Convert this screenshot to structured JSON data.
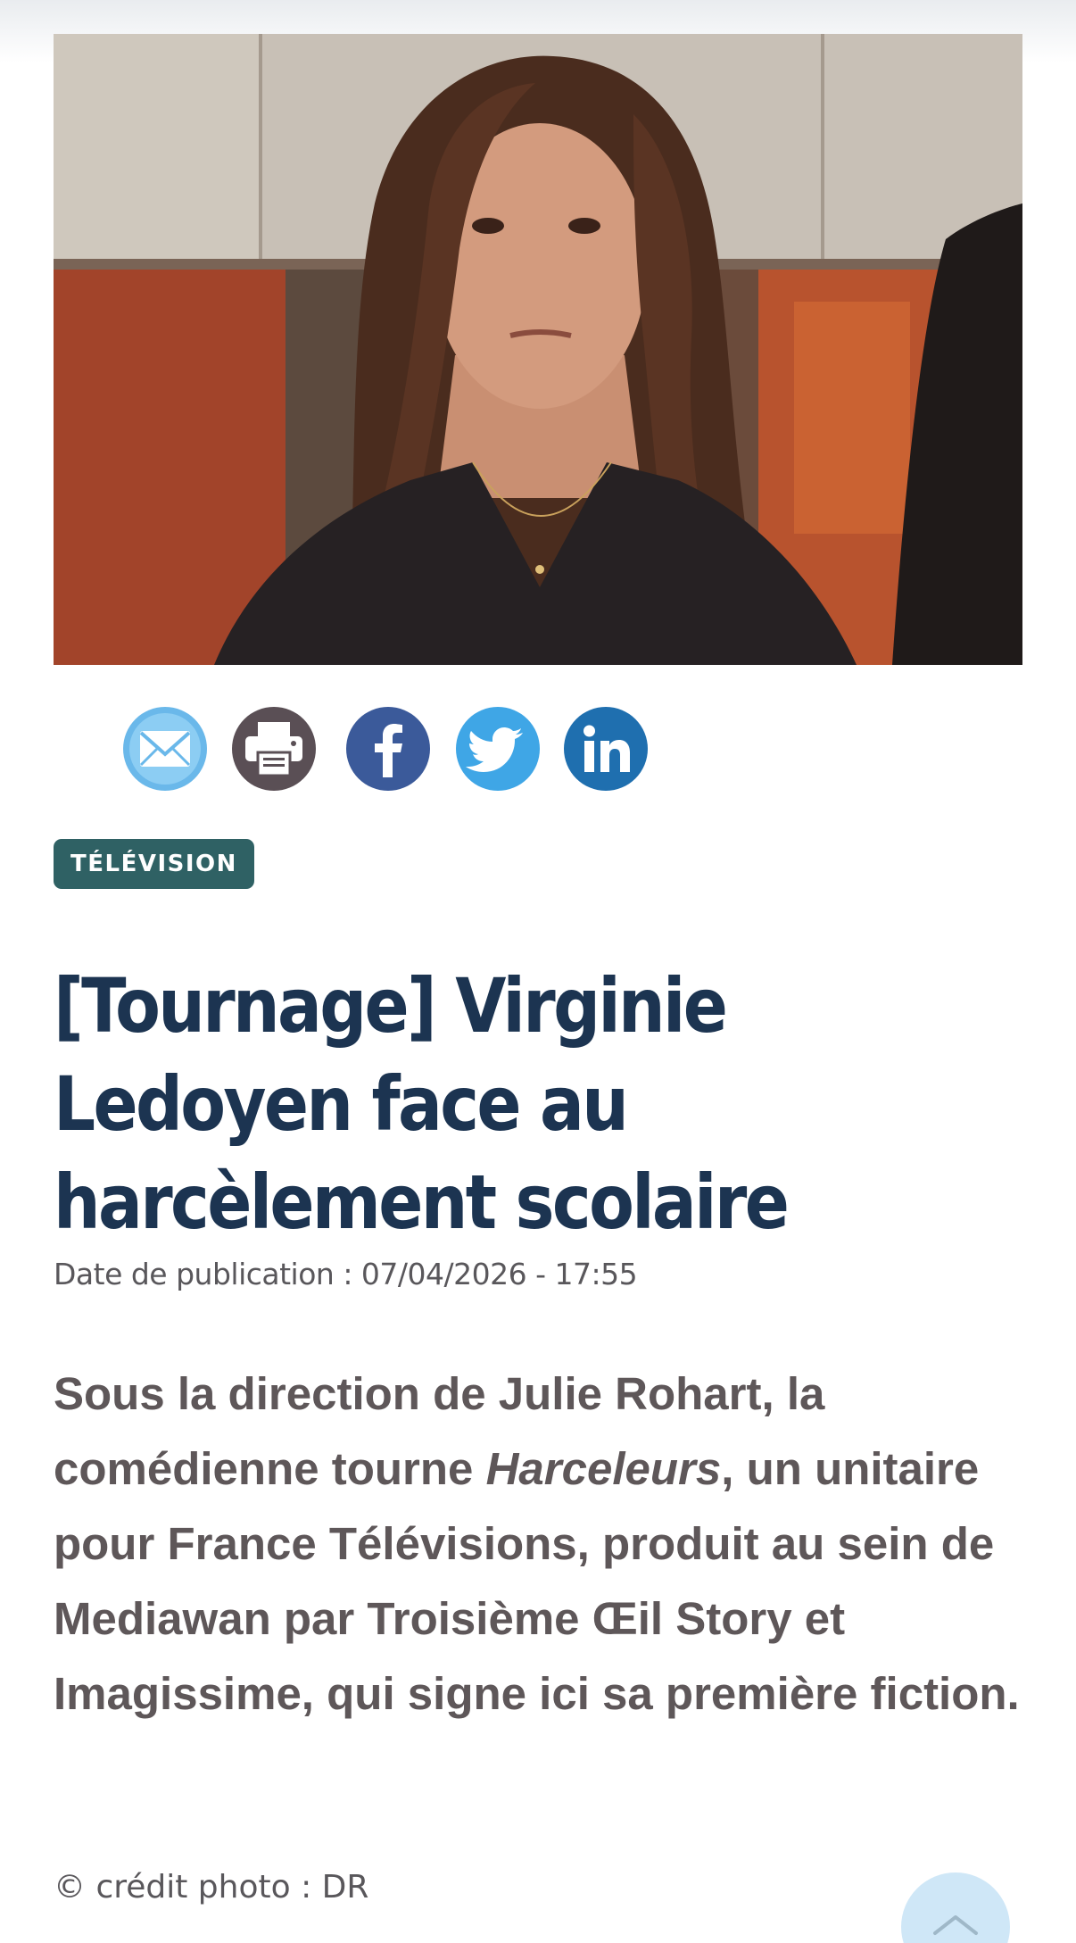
{
  "hero_image": {
    "alt": "",
    "icon": "photo-of-woman"
  },
  "share": {
    "items": [
      {
        "id": "email",
        "icon": "envelope-icon",
        "color": "#6ab8ea"
      },
      {
        "id": "print",
        "icon": "printer-icon",
        "color": "#5a4f55"
      },
      {
        "id": "facebook",
        "icon": "facebook-icon",
        "color": "#3b5a9a"
      },
      {
        "id": "twitter",
        "icon": "twitter-bird-icon",
        "color": "#3fa6e6"
      },
      {
        "id": "linkedin",
        "icon": "linkedin-icon",
        "color": "#1f6faf"
      }
    ]
  },
  "article": {
    "category": "TÉLÉVISION",
    "title": "[Tournage] Virginie Ledoyen face au harcèlement scolaire",
    "date_label": "Date de publication : 07/04/2026 - 17:55",
    "lede_part1": "Sous la direction de Julie Rohart, la comédienne tourne ",
    "lede_italic": "Harceleurs",
    "lede_part2": ", un unitaire pour France Télévisions, produit au sein de Mediawan par Troisième Œil Story et Imagissime, qui signe ici sa première fiction.",
    "photo_credit": "© crédit photo : DR"
  },
  "colors": {
    "category_bg": "#2f6164",
    "title": "#1c3451",
    "lede": "#5e5759",
    "back_to_top": "#cfe7f7"
  },
  "back_to_top": {
    "icon": "chevron-up-icon"
  }
}
